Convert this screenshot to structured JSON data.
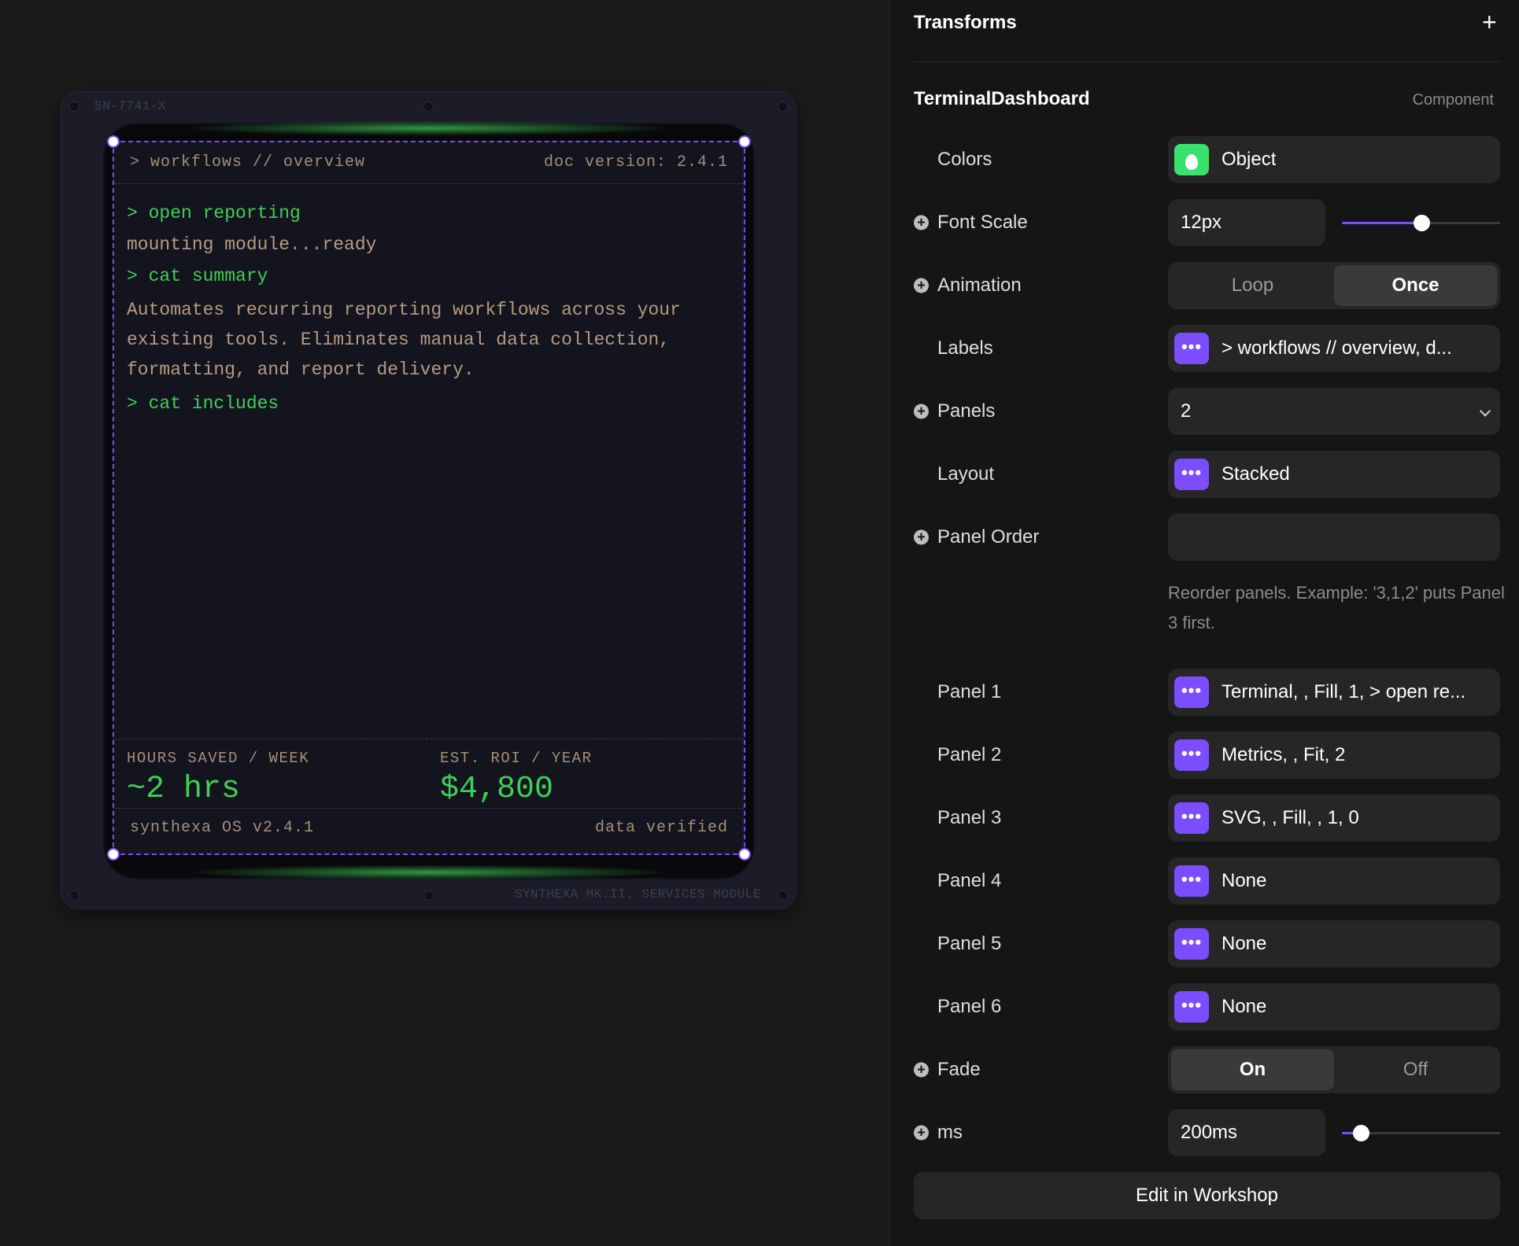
{
  "device": {
    "serial": "SN-7741-X",
    "module_label": "SYNTHEXA MK.II. SERVICES MODULE",
    "header_left": "> workflows // overview",
    "header_right": "doc version: 2.4.1",
    "terminal": {
      "cmd_open": "> open reporting",
      "out_mount": "mounting module...ready",
      "cmd_summary": "> cat summary",
      "summary_line1": "Automates recurring reporting workflows across your",
      "summary_line2": "existing tools. Eliminates manual data collection,",
      "summary_line3": "formatting, and report delivery.",
      "cmd_includes": "> cat includes"
    },
    "metrics": [
      {
        "label": "HOURS SAVED / WEEK",
        "value": "~2 hrs"
      },
      {
        "label": "EST. ROI / YEAR",
        "value": "$4,800"
      }
    ],
    "footer_left": "synthexa OS v2.4.1",
    "footer_right": "data verified",
    "colors": {
      "accent_green": "#3dcf58",
      "text_amber": "#b69b82",
      "selection": "#7b4df0"
    }
  },
  "panel": {
    "title": "Transforms",
    "add_icon": "plus-icon",
    "component_name": "TerminalDashboard",
    "component_type": "Component",
    "colors": {
      "label": "Colors",
      "value": "Object"
    },
    "font_scale": {
      "label": "Font Scale",
      "value": "12px",
      "slider_fraction": 0.5
    },
    "animation": {
      "label": "Animation",
      "options": [
        "Loop",
        "Once"
      ],
      "selected": "Once"
    },
    "labels": {
      "label": "Labels",
      "value": "> workflows // overview, d..."
    },
    "panels": {
      "label": "Panels",
      "value": "2"
    },
    "layout": {
      "label": "Layout",
      "value": "Stacked"
    },
    "panel_order": {
      "label": "Panel Order",
      "value": "",
      "hint": "Reorder panels. Example: '3,1,2' puts Panel 3 first."
    },
    "panel_items": [
      {
        "label": "Panel 1",
        "value": "Terminal, , Fill, 1, > open re..."
      },
      {
        "label": "Panel 2",
        "value": "Metrics, , Fit, 2"
      },
      {
        "label": "Panel 3",
        "value": "SVG, , Fill, , 1, 0"
      },
      {
        "label": "Panel 4",
        "value": "None"
      },
      {
        "label": "Panel 5",
        "value": "None"
      },
      {
        "label": "Panel 6",
        "value": "None"
      }
    ],
    "fade": {
      "label": "Fade",
      "options": [
        "On",
        "Off"
      ],
      "selected": "On"
    },
    "ms": {
      "label": "ms",
      "value": "200ms",
      "slider_fraction": 0.12
    },
    "edit_button": "Edit in Workshop",
    "accent": "#7c4dff"
  }
}
